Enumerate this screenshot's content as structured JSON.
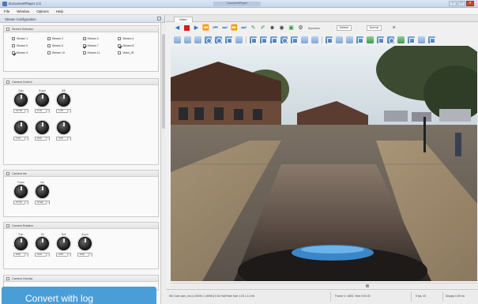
{
  "window": {
    "title": "DocumentPlayer 2.0",
    "center_title": "DocumentPlayer",
    "min_label": "–",
    "max_label": "□",
    "close_label": "×"
  },
  "menu": [
    "File",
    "Window",
    "Options",
    "Help"
  ],
  "left_panel": {
    "title": "Stream Configuration",
    "groups": {
      "stream_selection": {
        "title": "Stream Selection",
        "streams": [
          {
            "label": "Stream 1",
            "checked": false
          },
          {
            "label": "Stream 2",
            "checked": false
          },
          {
            "label": "Stream 3",
            "checked": false
          },
          {
            "label": "Stream 4",
            "checked": false
          },
          {
            "label": "Stream 5",
            "checked": false
          },
          {
            "label": "Stream 6",
            "checked": false
          },
          {
            "label": "Stream 7",
            "checked": true
          },
          {
            "label": "Stream 8",
            "checked": true
          },
          {
            "label": "Stream 9",
            "checked": true
          },
          {
            "label": "Stream 10",
            "checked": false
          },
          {
            "label": "Stream 11",
            "checked": false
          },
          {
            "label": "Video_IR",
            "checked": false
          }
        ]
      },
      "camera_control": {
        "title": "Camera Control",
        "row1_labels": [
          "Gain",
          "Expos",
          "WB"
        ],
        "row1_values": [
          "19.48",
          "0.19",
          "1.08"
        ],
        "row2_labels": [
          "",
          "",
          ""
        ],
        "row2_values": [
          "1.00",
          "0.00",
          "0.00"
        ]
      },
      "camera_iris": {
        "title": "Camera Iris",
        "labels": [
          "Focus",
          "Iris"
        ],
        "values": [
          "27.00",
          "Small"
        ]
      },
      "camera_rotation": {
        "title": "Camera Rotation",
        "labels": [
          "Pan",
          "Tilt",
          "Roll",
          "Zoom"
        ],
        "values": [
          "0.00",
          "0.00",
          "0.00",
          "0.00"
        ]
      },
      "camera_overlay": {
        "title": "Camera Overlay"
      }
    }
  },
  "video_tab": {
    "label": "Video"
  },
  "toolbar": {
    "selector1": "Synchron",
    "dropdown1": "Default",
    "dropdown2": "Normal"
  },
  "status": {
    "info": "WD Cam cam_ind (1.00000, 1.00981) 5.52  Half Rate  Size 1.00 1.1.0.06",
    "frame": "Frame 0 / 1805, Time 0:00.00",
    "fps": "5 fps, 00",
    "display": "Display 0.05 ms"
  },
  "cta": {
    "label": "Convert with log"
  },
  "colors": {
    "accent": "#2a6fc4",
    "record": "#d32020",
    "cta": "#4a9ed8"
  }
}
